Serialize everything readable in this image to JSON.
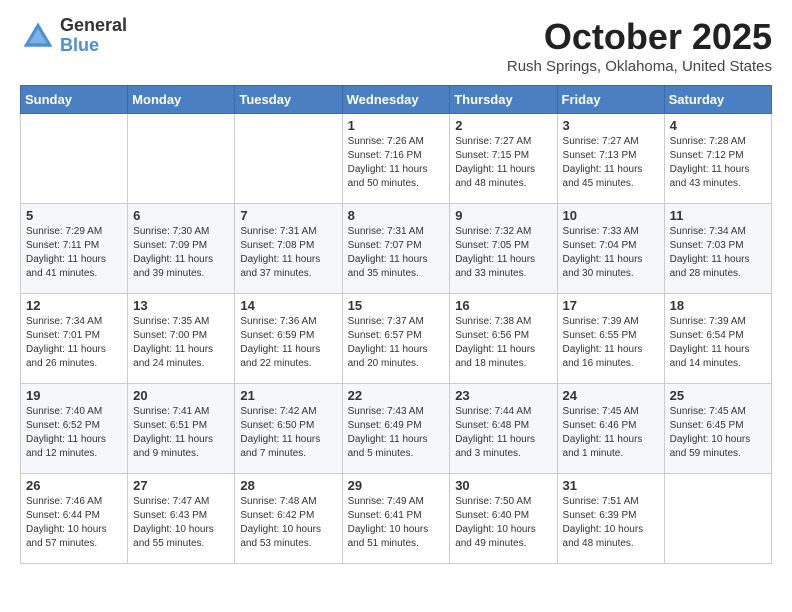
{
  "logo": {
    "general": "General",
    "blue": "Blue"
  },
  "header": {
    "month": "October 2025",
    "location": "Rush Springs, Oklahoma, United States"
  },
  "weekdays": [
    "Sunday",
    "Monday",
    "Tuesday",
    "Wednesday",
    "Thursday",
    "Friday",
    "Saturday"
  ],
  "weeks": [
    [
      {
        "day": "",
        "info": ""
      },
      {
        "day": "",
        "info": ""
      },
      {
        "day": "",
        "info": ""
      },
      {
        "day": "1",
        "info": "Sunrise: 7:26 AM\nSunset: 7:16 PM\nDaylight: 11 hours\nand 50 minutes."
      },
      {
        "day": "2",
        "info": "Sunrise: 7:27 AM\nSunset: 7:15 PM\nDaylight: 11 hours\nand 48 minutes."
      },
      {
        "day": "3",
        "info": "Sunrise: 7:27 AM\nSunset: 7:13 PM\nDaylight: 11 hours\nand 45 minutes."
      },
      {
        "day": "4",
        "info": "Sunrise: 7:28 AM\nSunset: 7:12 PM\nDaylight: 11 hours\nand 43 minutes."
      }
    ],
    [
      {
        "day": "5",
        "info": "Sunrise: 7:29 AM\nSunset: 7:11 PM\nDaylight: 11 hours\nand 41 minutes."
      },
      {
        "day": "6",
        "info": "Sunrise: 7:30 AM\nSunset: 7:09 PM\nDaylight: 11 hours\nand 39 minutes."
      },
      {
        "day": "7",
        "info": "Sunrise: 7:31 AM\nSunset: 7:08 PM\nDaylight: 11 hours\nand 37 minutes."
      },
      {
        "day": "8",
        "info": "Sunrise: 7:31 AM\nSunset: 7:07 PM\nDaylight: 11 hours\nand 35 minutes."
      },
      {
        "day": "9",
        "info": "Sunrise: 7:32 AM\nSunset: 7:05 PM\nDaylight: 11 hours\nand 33 minutes."
      },
      {
        "day": "10",
        "info": "Sunrise: 7:33 AM\nSunset: 7:04 PM\nDaylight: 11 hours\nand 30 minutes."
      },
      {
        "day": "11",
        "info": "Sunrise: 7:34 AM\nSunset: 7:03 PM\nDaylight: 11 hours\nand 28 minutes."
      }
    ],
    [
      {
        "day": "12",
        "info": "Sunrise: 7:34 AM\nSunset: 7:01 PM\nDaylight: 11 hours\nand 26 minutes."
      },
      {
        "day": "13",
        "info": "Sunrise: 7:35 AM\nSunset: 7:00 PM\nDaylight: 11 hours\nand 24 minutes."
      },
      {
        "day": "14",
        "info": "Sunrise: 7:36 AM\nSunset: 6:59 PM\nDaylight: 11 hours\nand 22 minutes."
      },
      {
        "day": "15",
        "info": "Sunrise: 7:37 AM\nSunset: 6:57 PM\nDaylight: 11 hours\nand 20 minutes."
      },
      {
        "day": "16",
        "info": "Sunrise: 7:38 AM\nSunset: 6:56 PM\nDaylight: 11 hours\nand 18 minutes."
      },
      {
        "day": "17",
        "info": "Sunrise: 7:39 AM\nSunset: 6:55 PM\nDaylight: 11 hours\nand 16 minutes."
      },
      {
        "day": "18",
        "info": "Sunrise: 7:39 AM\nSunset: 6:54 PM\nDaylight: 11 hours\nand 14 minutes."
      }
    ],
    [
      {
        "day": "19",
        "info": "Sunrise: 7:40 AM\nSunset: 6:52 PM\nDaylight: 11 hours\nand 12 minutes."
      },
      {
        "day": "20",
        "info": "Sunrise: 7:41 AM\nSunset: 6:51 PM\nDaylight: 11 hours\nand 9 minutes."
      },
      {
        "day": "21",
        "info": "Sunrise: 7:42 AM\nSunset: 6:50 PM\nDaylight: 11 hours\nand 7 minutes."
      },
      {
        "day": "22",
        "info": "Sunrise: 7:43 AM\nSunset: 6:49 PM\nDaylight: 11 hours\nand 5 minutes."
      },
      {
        "day": "23",
        "info": "Sunrise: 7:44 AM\nSunset: 6:48 PM\nDaylight: 11 hours\nand 3 minutes."
      },
      {
        "day": "24",
        "info": "Sunrise: 7:45 AM\nSunset: 6:46 PM\nDaylight: 11 hours\nand 1 minute."
      },
      {
        "day": "25",
        "info": "Sunrise: 7:45 AM\nSunset: 6:45 PM\nDaylight: 10 hours\nand 59 minutes."
      }
    ],
    [
      {
        "day": "26",
        "info": "Sunrise: 7:46 AM\nSunset: 6:44 PM\nDaylight: 10 hours\nand 57 minutes."
      },
      {
        "day": "27",
        "info": "Sunrise: 7:47 AM\nSunset: 6:43 PM\nDaylight: 10 hours\nand 55 minutes."
      },
      {
        "day": "28",
        "info": "Sunrise: 7:48 AM\nSunset: 6:42 PM\nDaylight: 10 hours\nand 53 minutes."
      },
      {
        "day": "29",
        "info": "Sunrise: 7:49 AM\nSunset: 6:41 PM\nDaylight: 10 hours\nand 51 minutes."
      },
      {
        "day": "30",
        "info": "Sunrise: 7:50 AM\nSunset: 6:40 PM\nDaylight: 10 hours\nand 49 minutes."
      },
      {
        "day": "31",
        "info": "Sunrise: 7:51 AM\nSunset: 6:39 PM\nDaylight: 10 hours\nand 48 minutes."
      },
      {
        "day": "",
        "info": ""
      }
    ]
  ]
}
